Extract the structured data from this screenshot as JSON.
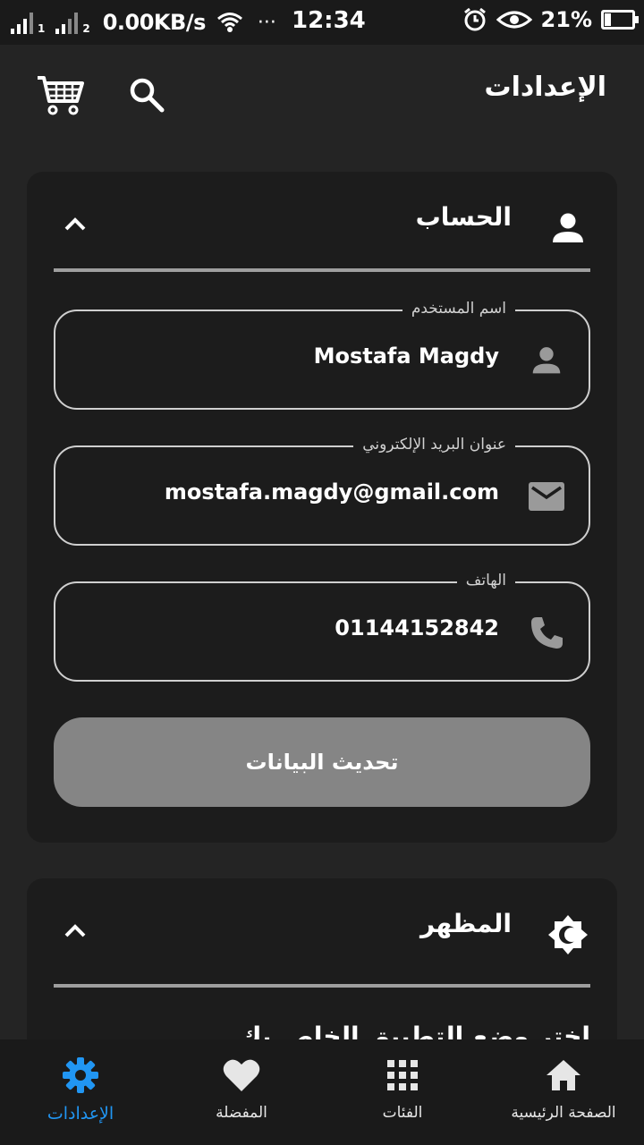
{
  "status_bar": {
    "sim1": "1",
    "sim2": "2",
    "net_speed": "0.00KB/s",
    "dots": "···",
    "time": "12:34",
    "battery_pct": "21%",
    "battery_level": 0.21
  },
  "app_bar": {
    "title": "الإعدادات",
    "search_icon": "search-icon",
    "cart_icon": "cart-icon"
  },
  "account_section": {
    "title": "الحساب",
    "icon": "person-icon",
    "fields": {
      "username": {
        "label": "اسم المستخدم",
        "value": "Mostafa Magdy",
        "icon": "person-icon"
      },
      "email": {
        "label": "عنوان البريد الإلكتروني",
        "value": "mostafa.magdy@gmail.com",
        "icon": "mail-icon"
      },
      "phone": {
        "label": "الهاتف",
        "value": "01144152842",
        "icon": "phone-icon"
      }
    },
    "update_button": "تحديث البيانات"
  },
  "appearance_section": {
    "title": "المظهر",
    "icon": "brightness-icon",
    "prompt": "اختر وضع التطبيق الخاص بك"
  },
  "bottom_nav": {
    "items": [
      {
        "label": "الصفحة الرئيسية",
        "icon": "home-icon",
        "active": false
      },
      {
        "label": "الفئات",
        "icon": "apps-grid-icon",
        "active": false
      },
      {
        "label": "المفضلة",
        "icon": "heart-icon",
        "active": false
      },
      {
        "label": "الإعدادات",
        "icon": "gear-icon",
        "active": true
      }
    ]
  },
  "colors": {
    "background": "#242424",
    "card": "#1c1c1c",
    "accent": "#2196f3",
    "button": "#858585"
  }
}
